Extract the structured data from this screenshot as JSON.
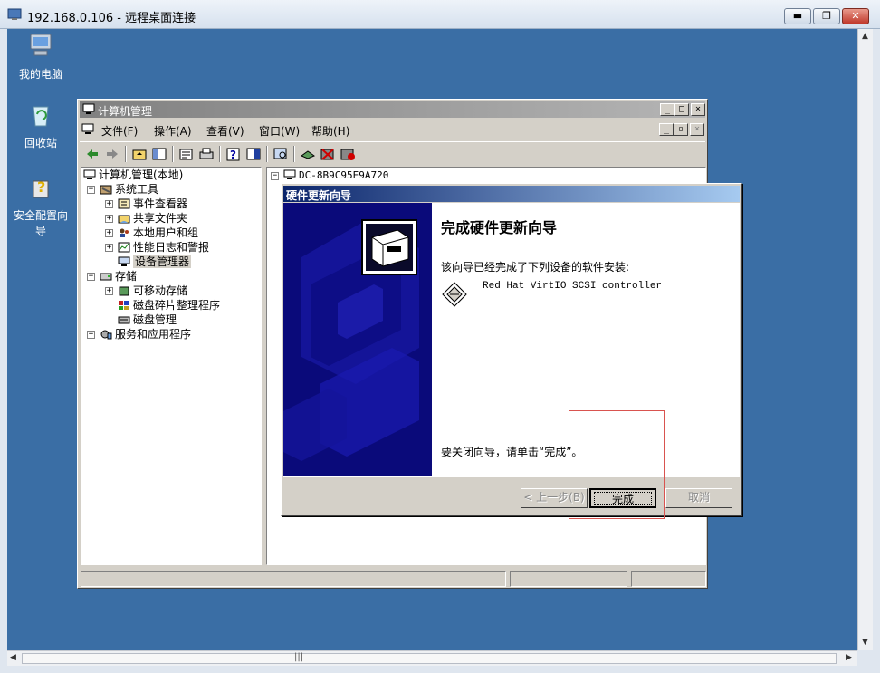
{
  "rdp": {
    "title": "192.168.0.106 - 远程桌面连接",
    "minimize": "▬",
    "restore": "❐",
    "close": "✕"
  },
  "desktop_icons": [
    {
      "label": "我的电脑",
      "icon": "my-computer-icon"
    },
    {
      "label": "回收站",
      "icon": "recycle-bin-icon"
    },
    {
      "label": "安全配置向导",
      "icon": "security-wizard-icon"
    }
  ],
  "mmc": {
    "title": "计算机管理",
    "menus": [
      "文件(F)",
      "操作(A)",
      "查看(V)",
      "窗口(W)",
      "帮助(H)"
    ],
    "tree": {
      "root": "计算机管理(本地)",
      "system_tools": "系统工具",
      "event_viewer": "事件查看器",
      "shared_folders": "共享文件夹",
      "local_users": "本地用户和组",
      "perf_logs": "性能日志和警报",
      "device_manager": "设备管理器",
      "storage": "存储",
      "removable_storage": "可移动存储",
      "defrag": "磁盘碎片整理程序",
      "disk_mgmt": "磁盘管理",
      "services_apps": "服务和应用程序"
    },
    "right_node": "DC-8B9C95E9A720"
  },
  "wizard": {
    "title": "硬件更新向导",
    "heading": "完成硬件更新向导",
    "description": "该向导已经完成了下列设备的软件安装:",
    "device": "Red Hat VirtIO SCSI controller",
    "closing": "要关闭向导，请单击“完成”。",
    "back_label": "< 上一步(B)",
    "finish_label": "完成",
    "cancel_label": "取消"
  },
  "colors": {
    "desktop": "#3a6ea5",
    "wizard_titlebar": "#0a246a",
    "highlight": "#d9534f"
  }
}
